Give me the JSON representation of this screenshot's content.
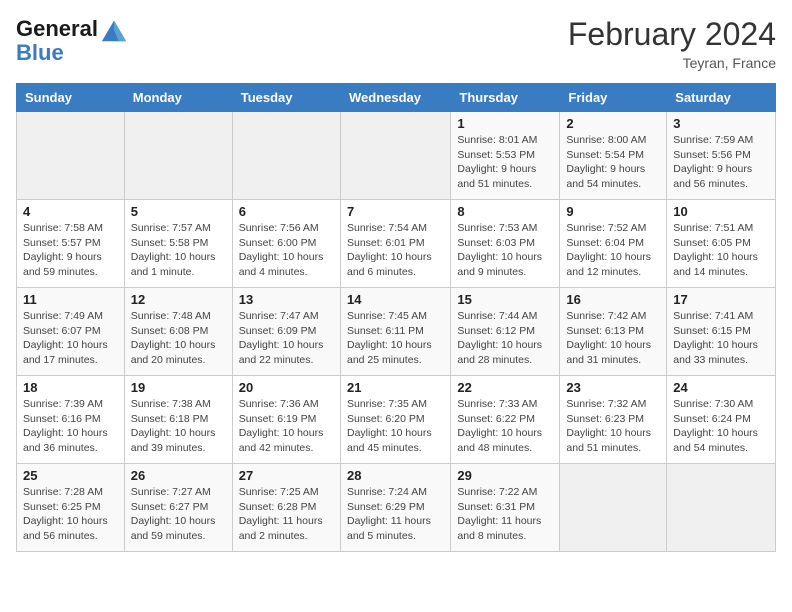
{
  "header": {
    "logo_line1": "General",
    "logo_line2": "Blue",
    "month_title": "February 2024",
    "location": "Teyran, France"
  },
  "days_of_week": [
    "Sunday",
    "Monday",
    "Tuesday",
    "Wednesday",
    "Thursday",
    "Friday",
    "Saturday"
  ],
  "weeks": [
    [
      {
        "day": "",
        "info": ""
      },
      {
        "day": "",
        "info": ""
      },
      {
        "day": "",
        "info": ""
      },
      {
        "day": "",
        "info": ""
      },
      {
        "day": "1",
        "info": "Sunrise: 8:01 AM\nSunset: 5:53 PM\nDaylight: 9 hours and 51 minutes."
      },
      {
        "day": "2",
        "info": "Sunrise: 8:00 AM\nSunset: 5:54 PM\nDaylight: 9 hours and 54 minutes."
      },
      {
        "day": "3",
        "info": "Sunrise: 7:59 AM\nSunset: 5:56 PM\nDaylight: 9 hours and 56 minutes."
      }
    ],
    [
      {
        "day": "4",
        "info": "Sunrise: 7:58 AM\nSunset: 5:57 PM\nDaylight: 9 hours and 59 minutes."
      },
      {
        "day": "5",
        "info": "Sunrise: 7:57 AM\nSunset: 5:58 PM\nDaylight: 10 hours and 1 minute."
      },
      {
        "day": "6",
        "info": "Sunrise: 7:56 AM\nSunset: 6:00 PM\nDaylight: 10 hours and 4 minutes."
      },
      {
        "day": "7",
        "info": "Sunrise: 7:54 AM\nSunset: 6:01 PM\nDaylight: 10 hours and 6 minutes."
      },
      {
        "day": "8",
        "info": "Sunrise: 7:53 AM\nSunset: 6:03 PM\nDaylight: 10 hours and 9 minutes."
      },
      {
        "day": "9",
        "info": "Sunrise: 7:52 AM\nSunset: 6:04 PM\nDaylight: 10 hours and 12 minutes."
      },
      {
        "day": "10",
        "info": "Sunrise: 7:51 AM\nSunset: 6:05 PM\nDaylight: 10 hours and 14 minutes."
      }
    ],
    [
      {
        "day": "11",
        "info": "Sunrise: 7:49 AM\nSunset: 6:07 PM\nDaylight: 10 hours and 17 minutes."
      },
      {
        "day": "12",
        "info": "Sunrise: 7:48 AM\nSunset: 6:08 PM\nDaylight: 10 hours and 20 minutes."
      },
      {
        "day": "13",
        "info": "Sunrise: 7:47 AM\nSunset: 6:09 PM\nDaylight: 10 hours and 22 minutes."
      },
      {
        "day": "14",
        "info": "Sunrise: 7:45 AM\nSunset: 6:11 PM\nDaylight: 10 hours and 25 minutes."
      },
      {
        "day": "15",
        "info": "Sunrise: 7:44 AM\nSunset: 6:12 PM\nDaylight: 10 hours and 28 minutes."
      },
      {
        "day": "16",
        "info": "Sunrise: 7:42 AM\nSunset: 6:13 PM\nDaylight: 10 hours and 31 minutes."
      },
      {
        "day": "17",
        "info": "Sunrise: 7:41 AM\nSunset: 6:15 PM\nDaylight: 10 hours and 33 minutes."
      }
    ],
    [
      {
        "day": "18",
        "info": "Sunrise: 7:39 AM\nSunset: 6:16 PM\nDaylight: 10 hours and 36 minutes."
      },
      {
        "day": "19",
        "info": "Sunrise: 7:38 AM\nSunset: 6:18 PM\nDaylight: 10 hours and 39 minutes."
      },
      {
        "day": "20",
        "info": "Sunrise: 7:36 AM\nSunset: 6:19 PM\nDaylight: 10 hours and 42 minutes."
      },
      {
        "day": "21",
        "info": "Sunrise: 7:35 AM\nSunset: 6:20 PM\nDaylight: 10 hours and 45 minutes."
      },
      {
        "day": "22",
        "info": "Sunrise: 7:33 AM\nSunset: 6:22 PM\nDaylight: 10 hours and 48 minutes."
      },
      {
        "day": "23",
        "info": "Sunrise: 7:32 AM\nSunset: 6:23 PM\nDaylight: 10 hours and 51 minutes."
      },
      {
        "day": "24",
        "info": "Sunrise: 7:30 AM\nSunset: 6:24 PM\nDaylight: 10 hours and 54 minutes."
      }
    ],
    [
      {
        "day": "25",
        "info": "Sunrise: 7:28 AM\nSunset: 6:25 PM\nDaylight: 10 hours and 56 minutes."
      },
      {
        "day": "26",
        "info": "Sunrise: 7:27 AM\nSunset: 6:27 PM\nDaylight: 10 hours and 59 minutes."
      },
      {
        "day": "27",
        "info": "Sunrise: 7:25 AM\nSunset: 6:28 PM\nDaylight: 11 hours and 2 minutes."
      },
      {
        "day": "28",
        "info": "Sunrise: 7:24 AM\nSunset: 6:29 PM\nDaylight: 11 hours and 5 minutes."
      },
      {
        "day": "29",
        "info": "Sunrise: 7:22 AM\nSunset: 6:31 PM\nDaylight: 11 hours and 8 minutes."
      },
      {
        "day": "",
        "info": ""
      },
      {
        "day": "",
        "info": ""
      }
    ]
  ]
}
